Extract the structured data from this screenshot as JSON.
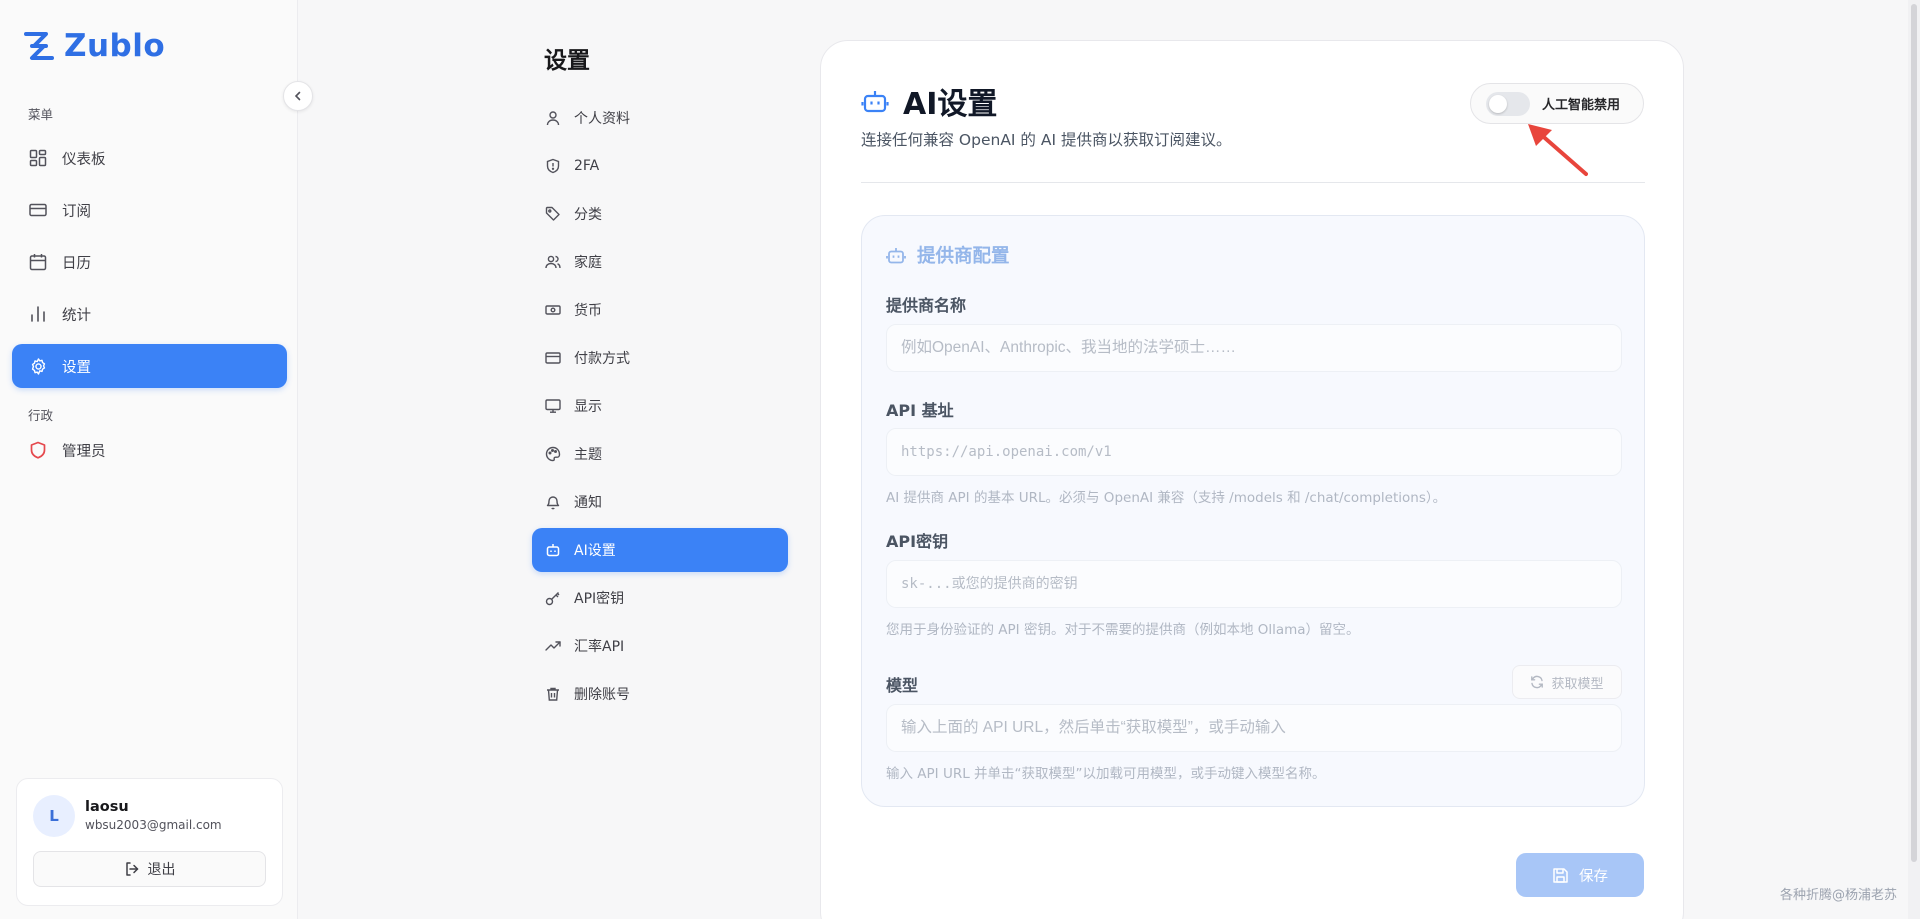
{
  "app": {
    "name": "Zublo",
    "brand_color": "#2f6fe4"
  },
  "sidebar": {
    "section_menu": "菜单",
    "items": [
      {
        "label": "仪表板",
        "icon": "dashboard-icon"
      },
      {
        "label": "订阅",
        "icon": "card-icon"
      },
      {
        "label": "日历",
        "icon": "calendar-icon"
      },
      {
        "label": "统计",
        "icon": "chart-icon"
      },
      {
        "label": "设置",
        "icon": "gear-icon",
        "active": true
      }
    ],
    "section_admin": "行政",
    "admin_items": [
      {
        "label": "管理员",
        "icon": "shield-icon"
      }
    ]
  },
  "user": {
    "initial": "L",
    "name": "laosu",
    "email": "wbsu2003@gmail.com",
    "logout_label": "退出"
  },
  "settings_nav": {
    "title": "设置",
    "items": [
      {
        "label": "个人资料",
        "icon": "user-icon"
      },
      {
        "label": "2FA",
        "icon": "shield-check-icon"
      },
      {
        "label": "分类",
        "icon": "tag-icon"
      },
      {
        "label": "家庭",
        "icon": "users-icon"
      },
      {
        "label": "货币",
        "icon": "banknote-icon"
      },
      {
        "label": "付款方式",
        "icon": "credit-card-icon"
      },
      {
        "label": "显示",
        "icon": "monitor-icon"
      },
      {
        "label": "主题",
        "icon": "palette-icon"
      },
      {
        "label": "通知",
        "icon": "bell-icon"
      },
      {
        "label": "AI设置",
        "icon": "bot-icon",
        "active": true
      },
      {
        "label": "API密钥",
        "icon": "key-icon"
      },
      {
        "label": "汇率API",
        "icon": "trending-up-icon"
      },
      {
        "label": "删除账号",
        "icon": "trash-icon"
      }
    ]
  },
  "ai_settings": {
    "title": "AI设置",
    "subtitle": "连接任何兼容 OpenAI 的 AI 提供商以获取订阅建议。",
    "toggle_label": "人工智能禁用",
    "toggle_on": false,
    "provider": {
      "title": "提供商配置",
      "name_label": "提供商名称",
      "name_placeholder": "例如OpenAI、Anthropic、我当地的法学硕士……",
      "name_value": "",
      "base_url_label": "API 基址",
      "base_url_placeholder": "https://api.openai.com/v1",
      "base_url_value": "",
      "base_url_help": "AI 提供商 API 的基本 URL。必须与 OpenAI 兼容（支持 /models 和 /chat/completions）。",
      "key_label": "API密钥",
      "key_placeholder": "sk-...或您的提供商的密钥",
      "key_value": "",
      "key_help": "您用于身份验证的 API 密钥。对于不需要的提供商（例如本地 Ollama）留空。",
      "model_label": "模型",
      "fetch_models_label": "获取模型",
      "model_placeholder": "输入上面的 API URL，然后单击“获取模型”，或手动输入",
      "model_value": "",
      "model_help": "输入 API URL 并单击“获取模型”以加载可用模型，或手动键入模型名称。"
    },
    "save_label": "保存"
  },
  "watermark": "各种折腾@杨浦老苏",
  "colors": {
    "accent": "#3b82f6",
    "arrow": "#e8453c"
  }
}
